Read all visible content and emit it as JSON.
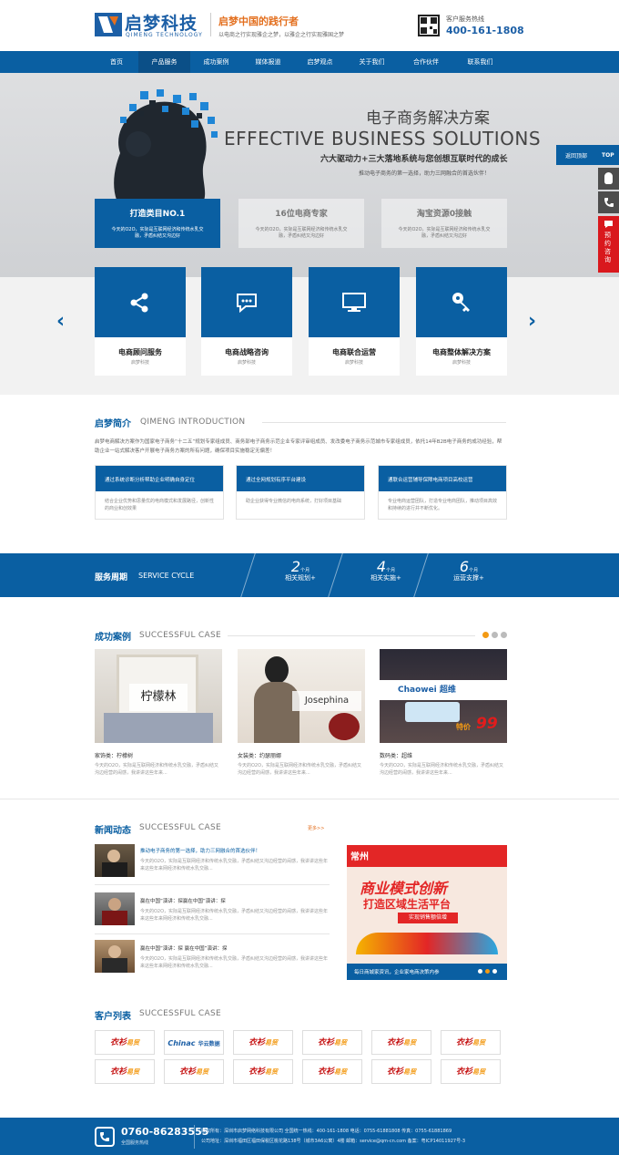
{
  "header": {
    "logo_name": "启梦科技",
    "logo_en": "QIMENG TECHNOLOGY",
    "slogan": "启梦中国的践行者",
    "slogan_sub": "以电商之行实现雅企之梦，以雅企之行实现雅国之梦",
    "hotline_label": "客户服务热线",
    "hotline": "400-161-1808"
  },
  "nav": {
    "items": [
      "首页",
      "产品服务",
      "成功案例",
      "媒体报道",
      "启梦观点",
      "关于我们",
      "合作伙伴",
      "联系我们"
    ],
    "active_index": 1
  },
  "hero": {
    "title_cn": "电子商务解决方案",
    "title_en": "EFFECTIVE BUSINESS SOLUTIONS",
    "sub1": "六大驱动力+三大落地系统与您创想互联时代的成长",
    "sub2": "推动电子商务的第一选择，助力三网融合的首选伙伴！",
    "cards": [
      {
        "title": "打造类目NO.1",
        "desc": "今天的O2O，实际是互联网经济和传统水乳交融，矛盾纠结又沟边好"
      },
      {
        "title": "16位电商专家",
        "desc": "今天的O2O，实际是互联网经济和传统水乳交融，矛盾纠结又沟边好"
      },
      {
        "title": "淘宝资源0接触",
        "desc": "今天的O2O，实际是互联网经济和传统水乳交融，矛盾纠结又沟边好"
      }
    ]
  },
  "services": [
    {
      "title": "电商顾问服务",
      "sub": "启梦科技",
      "icon": "share-icon"
    },
    {
      "title": "电商战略咨询",
      "sub": "启梦科技",
      "icon": "chat-icon"
    },
    {
      "title": "电商联合运营",
      "sub": "启梦科技",
      "icon": "monitor-icon"
    },
    {
      "title": "电商整体解决方案",
      "sub": "启梦科技",
      "icon": "key-icon"
    }
  ],
  "intro": {
    "title": "启梦简介",
    "title_en": "QIMENG INTRODUCTION",
    "text": "启梦电商解决方案作为国家电子商务“十二五”规划专家组成员、商务部电子商务示范企业专家评审组成员、发改委电子商务示范城市专家组成员，依托14年B2B电子商务的成功经验，帮助企业一站式解决客户开展电子商务方案的所有问题，确保项目实施稳定无偏差！",
    "features": [
      {
        "head": "通过系统诊断分析帮助企业明确自身定位",
        "body": "结合企业优势和思量优的电商模式和发展路径，创新性的商业和创效果"
      },
      {
        "head": "通过全网规划有序平台建设",
        "body": "助企业获得专业微信的电商系统，打好项目基础"
      },
      {
        "head": "通联合运营辅导保障电商项目高校运营",
        "body": "专业电商运营团队，打造专业电商团队，推动项目高效和持续的进行并不断优化。"
      }
    ]
  },
  "cycle": {
    "title": "服务周期",
    "title_en": "SERVICE CYCLE",
    "steps": [
      {
        "num": "2",
        "unit": "个月",
        "label": "相关规划+"
      },
      {
        "num": "4",
        "unit": "个月",
        "label": "相关实施+"
      },
      {
        "num": "6",
        "unit": "个月",
        "label": "运营支撑+"
      }
    ]
  },
  "cases": {
    "title": "成功案例",
    "title_en": "SUCCESSFUL CASE",
    "items": [
      {
        "category": "家饰类：柠檬树",
        "brand": "柠檬林",
        "desc": "今天的O2O，实际是互联网经济和传统水乳交融，矛盾纠结又沟边经营的闹感，我讲讲这些年来..."
      },
      {
        "category": "女装类：约瑟丽娜",
        "brand": "Josephina",
        "desc": "今天的O2O，实际是互联网经济和传统水乳交融，矛盾纠结又沟边经营的闹感，我讲讲这些年来..."
      },
      {
        "category": "数码类：超维",
        "brand": "Chaowei 超维",
        "desc": "今天的O2O，实际是互联网经济和传统水乳交融，矛盾纠结又沟边经营的闹感，我讲讲这些年来..."
      }
    ],
    "price_tag": "特价",
    "price": "99"
  },
  "news": {
    "title": "新闻动态",
    "title_en": "SUCCESSFUL CASE",
    "more": "更多>>",
    "items": [
      {
        "title": "推动电子商务的第一选择，助力三网融合的首选伙伴！",
        "desc": "今天的O2O，实际是互联网经济和传统水乳交融，矛盾纠结又沟边经营的闹感，我讲讲这些年来这些年来网经济和传统水乳交融..."
      },
      {
        "title": "赢在中国”演讲：探赢在中国”演讲：探",
        "desc": "今天的O2O，实际是互联网经济和传统水乳交融，矛盾纠结又沟边经营的闹感，我讲讲这些年来这些年来网经济和传统水乳交融..."
      },
      {
        "title": "赢在中国”演讲：探 赢在中国”演讲：探",
        "desc": "今天的O2O，实际是互联网经济和传统水乳交融，矛盾纠结又沟边经营的闹感，我讲讲这些年来这些年来网经济和传统水乳交融..."
      }
    ],
    "banner_logo": "常州",
    "banner_line1": "商业模式创新",
    "banner_line2": "打造区域生活平台",
    "banner_tag": "实现销售额倍增",
    "banner_text": "每日商城家资讯，企业家电商决策内参"
  },
  "clients": {
    "title": "客户列表",
    "title_en": "SUCCESSFUL CASE",
    "logos": [
      {
        "a": "衣衫",
        "b": "易贸"
      },
      {
        "a": "Chinac",
        "b": "华云数据"
      },
      {
        "a": "衣衫",
        "b": "易贸"
      },
      {
        "a": "衣衫",
        "b": "易贸"
      },
      {
        "a": "衣衫",
        "b": "易贸"
      },
      {
        "a": "衣衫",
        "b": "易贸"
      },
      {
        "a": "衣衫",
        "b": "易贸"
      },
      {
        "a": "衣衫",
        "b": "易贸"
      },
      {
        "a": "衣衫",
        "b": "易贸"
      },
      {
        "a": "衣衫",
        "b": "易贸"
      },
      {
        "a": "衣衫",
        "b": "易贸"
      },
      {
        "a": "衣衫",
        "b": "易贸"
      }
    ]
  },
  "footer": {
    "phone": "0760-86283555",
    "phone_sub": "全国服务热线",
    "line1": "版权所有：深圳市启梦网络科技有限公司    全国统一热线：400-161-1808    电话：0755-61881808    传真：0755-61881869",
    "line2": "公司地址：深圳市福田区福田保税区桃花路138号（城市3A6公寓）4楼    邮箱：service@qm-cn.com    备案：粤ICP14011927号-3"
  },
  "side": {
    "top_label": "返回顶部",
    "top_btn": "TOP",
    "reserve": "预约咨询"
  },
  "colors": {
    "primary": "#0a5fa2",
    "accent": "#e36f1e",
    "footer": "#0a5fa2"
  }
}
